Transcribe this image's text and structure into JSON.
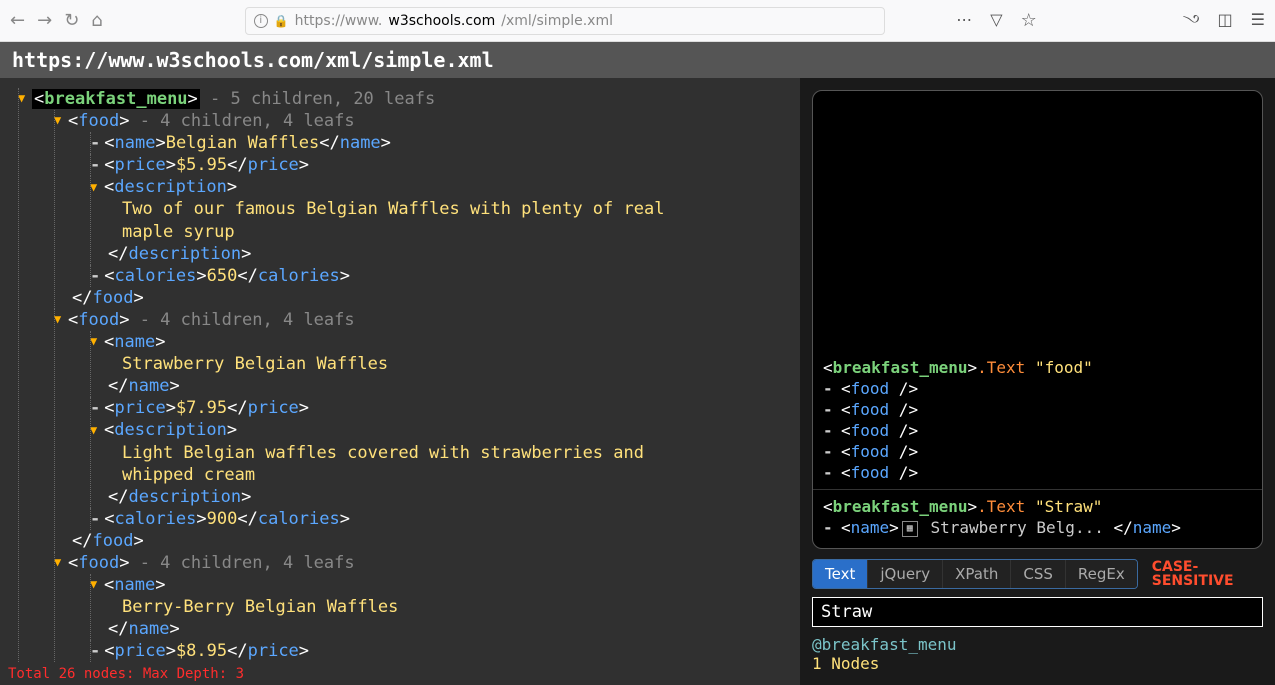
{
  "browser": {
    "url_pre": "https://www.",
    "url_host": "w3schools.com",
    "url_post": "/xml/simple.xml"
  },
  "page": {
    "header": "https://www.w3schools.com/xml/simple.xml"
  },
  "tree": {
    "root": {
      "tag": "breakfast_menu",
      "summary": " - 5 children, 20 leafs"
    },
    "food": [
      {
        "summary": " - 4 children, 4 leafs",
        "name": "Belgian Waffles",
        "price": "$5.95",
        "description": "Two of our famous Belgian Waffles with plenty of real maple syrup",
        "calories": "650"
      },
      {
        "summary": " - 4 children, 4 leafs",
        "name": "Strawberry Belgian Waffles",
        "price": "$7.95",
        "description": "Light Belgian waffles covered with strawberries and whipped cream",
        "calories": "900"
      },
      {
        "summary": " - 4 children, 4 leafs",
        "name": "Berry-Berry Belgian Waffles",
        "price": "$8.95"
      }
    ]
  },
  "status": "Total 26 nodes: Max Depth: 3",
  "side": {
    "results1": {
      "root": "breakfast_menu",
      "method": ".Text ",
      "query": "\"food\"",
      "items": [
        "food",
        "food",
        "food",
        "food",
        "food"
      ]
    },
    "results2": {
      "root": "breakfast_menu",
      "method": ".Text ",
      "query": "\"Straw\"",
      "item_tag": "name",
      "item_text": " Strawberry Belg... "
    },
    "tabs": [
      "Text",
      "jQuery",
      "XPath",
      "CSS",
      "RegEx"
    ],
    "active_tab": 0,
    "case_label": "CASE-SENSITIVE",
    "search_value": "Straw",
    "result_scope": "@breakfast_menu",
    "result_count": "1",
    "result_label": " Nodes"
  }
}
